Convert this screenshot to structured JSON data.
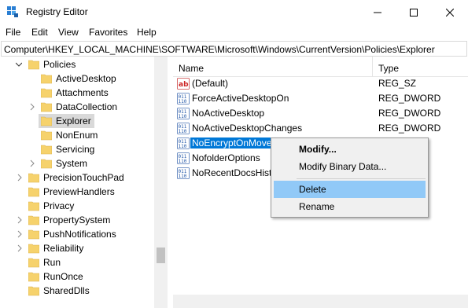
{
  "window": {
    "title": "Registry Editor"
  },
  "menu": [
    "File",
    "Edit",
    "View",
    "Favorites",
    "Help"
  ],
  "address": {
    "path": "Computer\\HKEY_LOCAL_MACHINE\\SOFTWARE\\Microsoft\\Windows\\CurrentVersion\\Policies\\Explorer"
  },
  "tree": {
    "items": [
      {
        "label": "Policies",
        "expander": "expanded"
      },
      {
        "label": "ActiveDesktop",
        "expander": "none"
      },
      {
        "label": "Attachments",
        "expander": "none"
      },
      {
        "label": "DataCollection",
        "expander": "collapsed"
      },
      {
        "label": "Explorer",
        "expander": "none",
        "selected": true
      },
      {
        "label": "NonEnum",
        "expander": "none"
      },
      {
        "label": "Servicing",
        "expander": "none"
      },
      {
        "label": "System",
        "expander": "collapsed"
      },
      {
        "label": "PrecisionTouchPad",
        "expander": "collapsed"
      },
      {
        "label": "PreviewHandlers",
        "expander": "none"
      },
      {
        "label": "Privacy",
        "expander": "none"
      },
      {
        "label": "PropertySystem",
        "expander": "collapsed"
      },
      {
        "label": "PushNotifications",
        "expander": "collapsed"
      },
      {
        "label": "Reliability",
        "expander": "collapsed"
      },
      {
        "label": "Run",
        "expander": "none"
      },
      {
        "label": "RunOnce",
        "expander": "none"
      },
      {
        "label": "SharedDlls",
        "expander": "none"
      }
    ]
  },
  "list": {
    "columns": {
      "name": "Name",
      "type": "Type"
    },
    "rows": [
      {
        "name": "(Default)",
        "type": "REG_SZ",
        "icon": "string-value-icon"
      },
      {
        "name": "ForceActiveDesktopOn",
        "type": "REG_DWORD",
        "icon": "binary-value-icon"
      },
      {
        "name": "NoActiveDesktop",
        "type": "REG_DWORD",
        "icon": "binary-value-icon"
      },
      {
        "name": "NoActiveDesktopChanges",
        "type": "REG_DWORD",
        "icon": "binary-value-icon"
      },
      {
        "name": "NoEncryptOnMove",
        "type": "",
        "icon": "binary-value-icon",
        "selected": true
      },
      {
        "name": "NofolderOptions",
        "type": "",
        "icon": "binary-value-icon"
      },
      {
        "name": "NoRecentDocsHisto",
        "type": "",
        "icon": "binary-value-icon"
      }
    ]
  },
  "context_menu": {
    "items": [
      {
        "label": "Modify...",
        "bold": true
      },
      {
        "label": "Modify Binary Data..."
      },
      {
        "label": "Delete",
        "hover": true
      },
      {
        "label": "Rename"
      }
    ]
  },
  "colors": {
    "selection": "#0078d7",
    "menu_hover": "#91c9f7",
    "folder": "#f6d26c"
  }
}
